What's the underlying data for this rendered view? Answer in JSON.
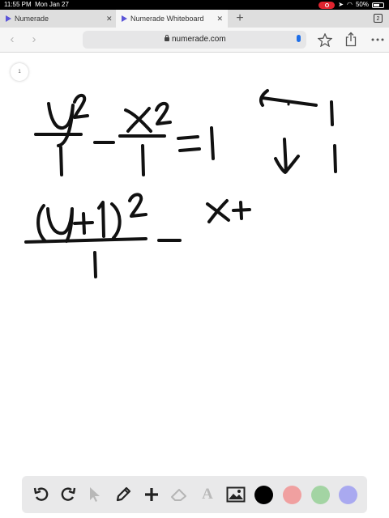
{
  "status": {
    "time": "11:55 PM",
    "date": "Mon Jan 27",
    "battery": "50%"
  },
  "tabs": [
    {
      "label": "Numerade",
      "active": false
    },
    {
      "label": "Numerade Whiteboard",
      "active": true
    }
  ],
  "tab_count": "2",
  "address": {
    "url": "numerade.com"
  },
  "page_number": "1",
  "toolbar": {
    "colors": [
      "#000000",
      "#f0a0a0",
      "#a3d4a3",
      "#a9a9f0"
    ],
    "text_tool_label": "A"
  }
}
